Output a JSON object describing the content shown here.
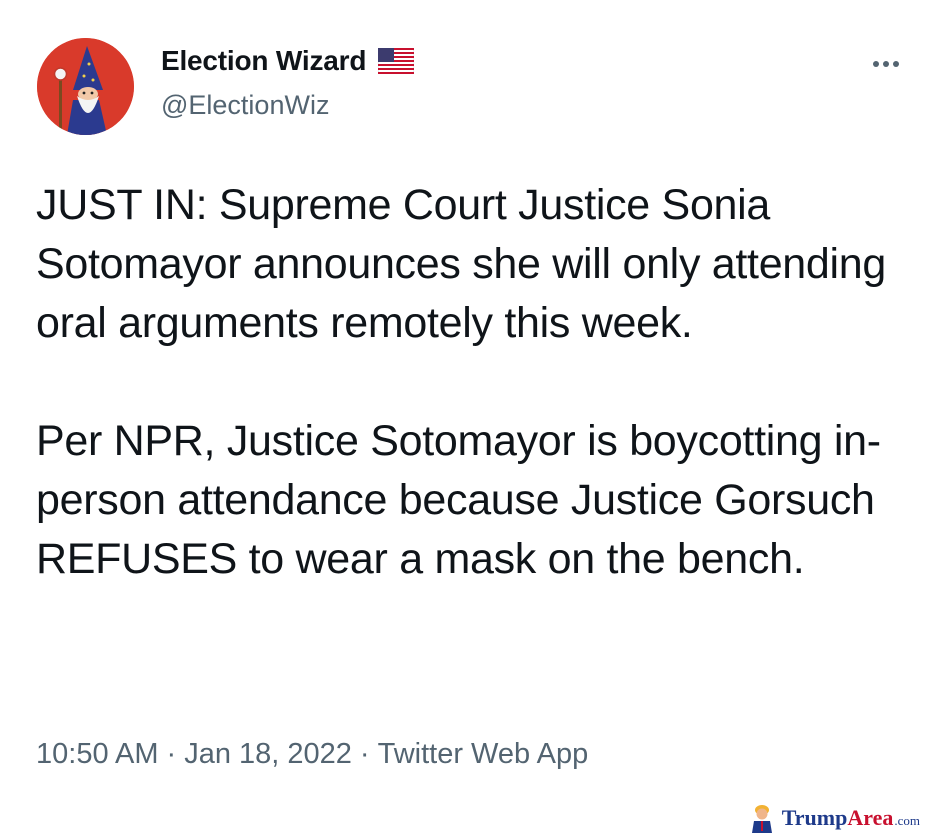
{
  "account": {
    "display_name": "Election Wizard",
    "handle": "@ElectionWiz",
    "flag_icon": "us-flag-icon",
    "avatar_icon": "wizard-avatar-icon"
  },
  "menu": {
    "icon": "more-dots-icon"
  },
  "tweet": {
    "paragraph_1": "JUST IN: Supreme Court Justice Sonia Sotomayor announces she will only attending oral arguments remotely this week.",
    "paragraph_2": "Per NPR, Justice Sotomayor is boycotting in-person attendance because Justice Gorsuch REFUSES to wear a mask on the bench."
  },
  "meta": {
    "time": "10:50 AM",
    "separator": "·",
    "date": "Jan 18, 2022",
    "source": "Twitter Web App"
  },
  "watermark": {
    "part_a": "Trump",
    "part_b": "Area",
    "part_c": ".com"
  },
  "colors": {
    "text": "#0f1419",
    "secondary": "#536471",
    "avatar_bg": "#d93a2b",
    "wizard_robe": "#2b3a8f"
  }
}
